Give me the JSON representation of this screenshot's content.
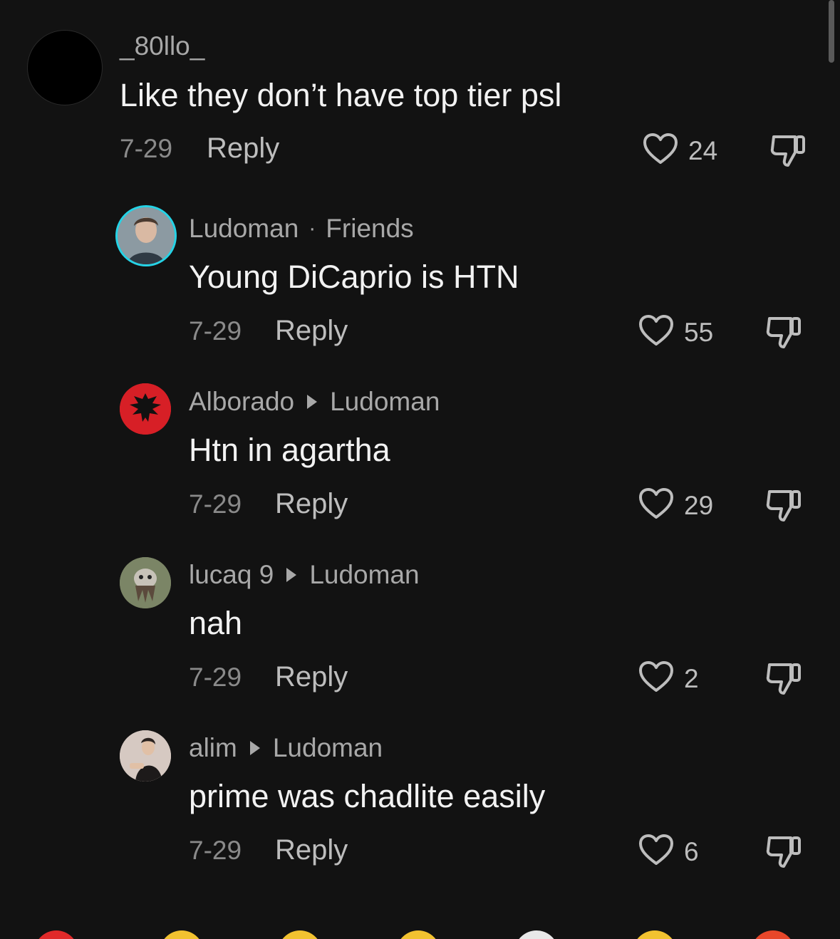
{
  "comments": [
    {
      "username": "_80llo_",
      "text": "Like they don’t have top tier psl",
      "date": "7-29",
      "reply_label": "Reply",
      "likes": "24"
    },
    {
      "username": "Ludoman",
      "tag": "Friends",
      "text": "Young DiCaprio is HTN",
      "date": "7-29",
      "reply_label": "Reply",
      "likes": "55"
    },
    {
      "username": "Alborado",
      "reply_to": "Ludoman",
      "text": "Htn in agartha",
      "date": "7-29",
      "reply_label": "Reply",
      "likes": "29"
    },
    {
      "username": "lucaq 9",
      "reply_to": "Ludoman",
      "text": "nah",
      "date": "7-29",
      "reply_label": "Reply",
      "likes": "2"
    },
    {
      "username": "alim",
      "reply_to": "Ludoman",
      "text": "prime was chadlite easily",
      "date": "7-29",
      "reply_label": "Reply",
      "likes": "6"
    }
  ],
  "icons": {
    "like": "heart-outline-icon",
    "dislike": "thumbs-down-icon",
    "thread_arrow": "triangle-right-icon"
  },
  "colors": {
    "background": "#121212",
    "text": "#f2f2f2",
    "muted": "#a8a8a8",
    "avatar_ring": "#25d3e6"
  }
}
